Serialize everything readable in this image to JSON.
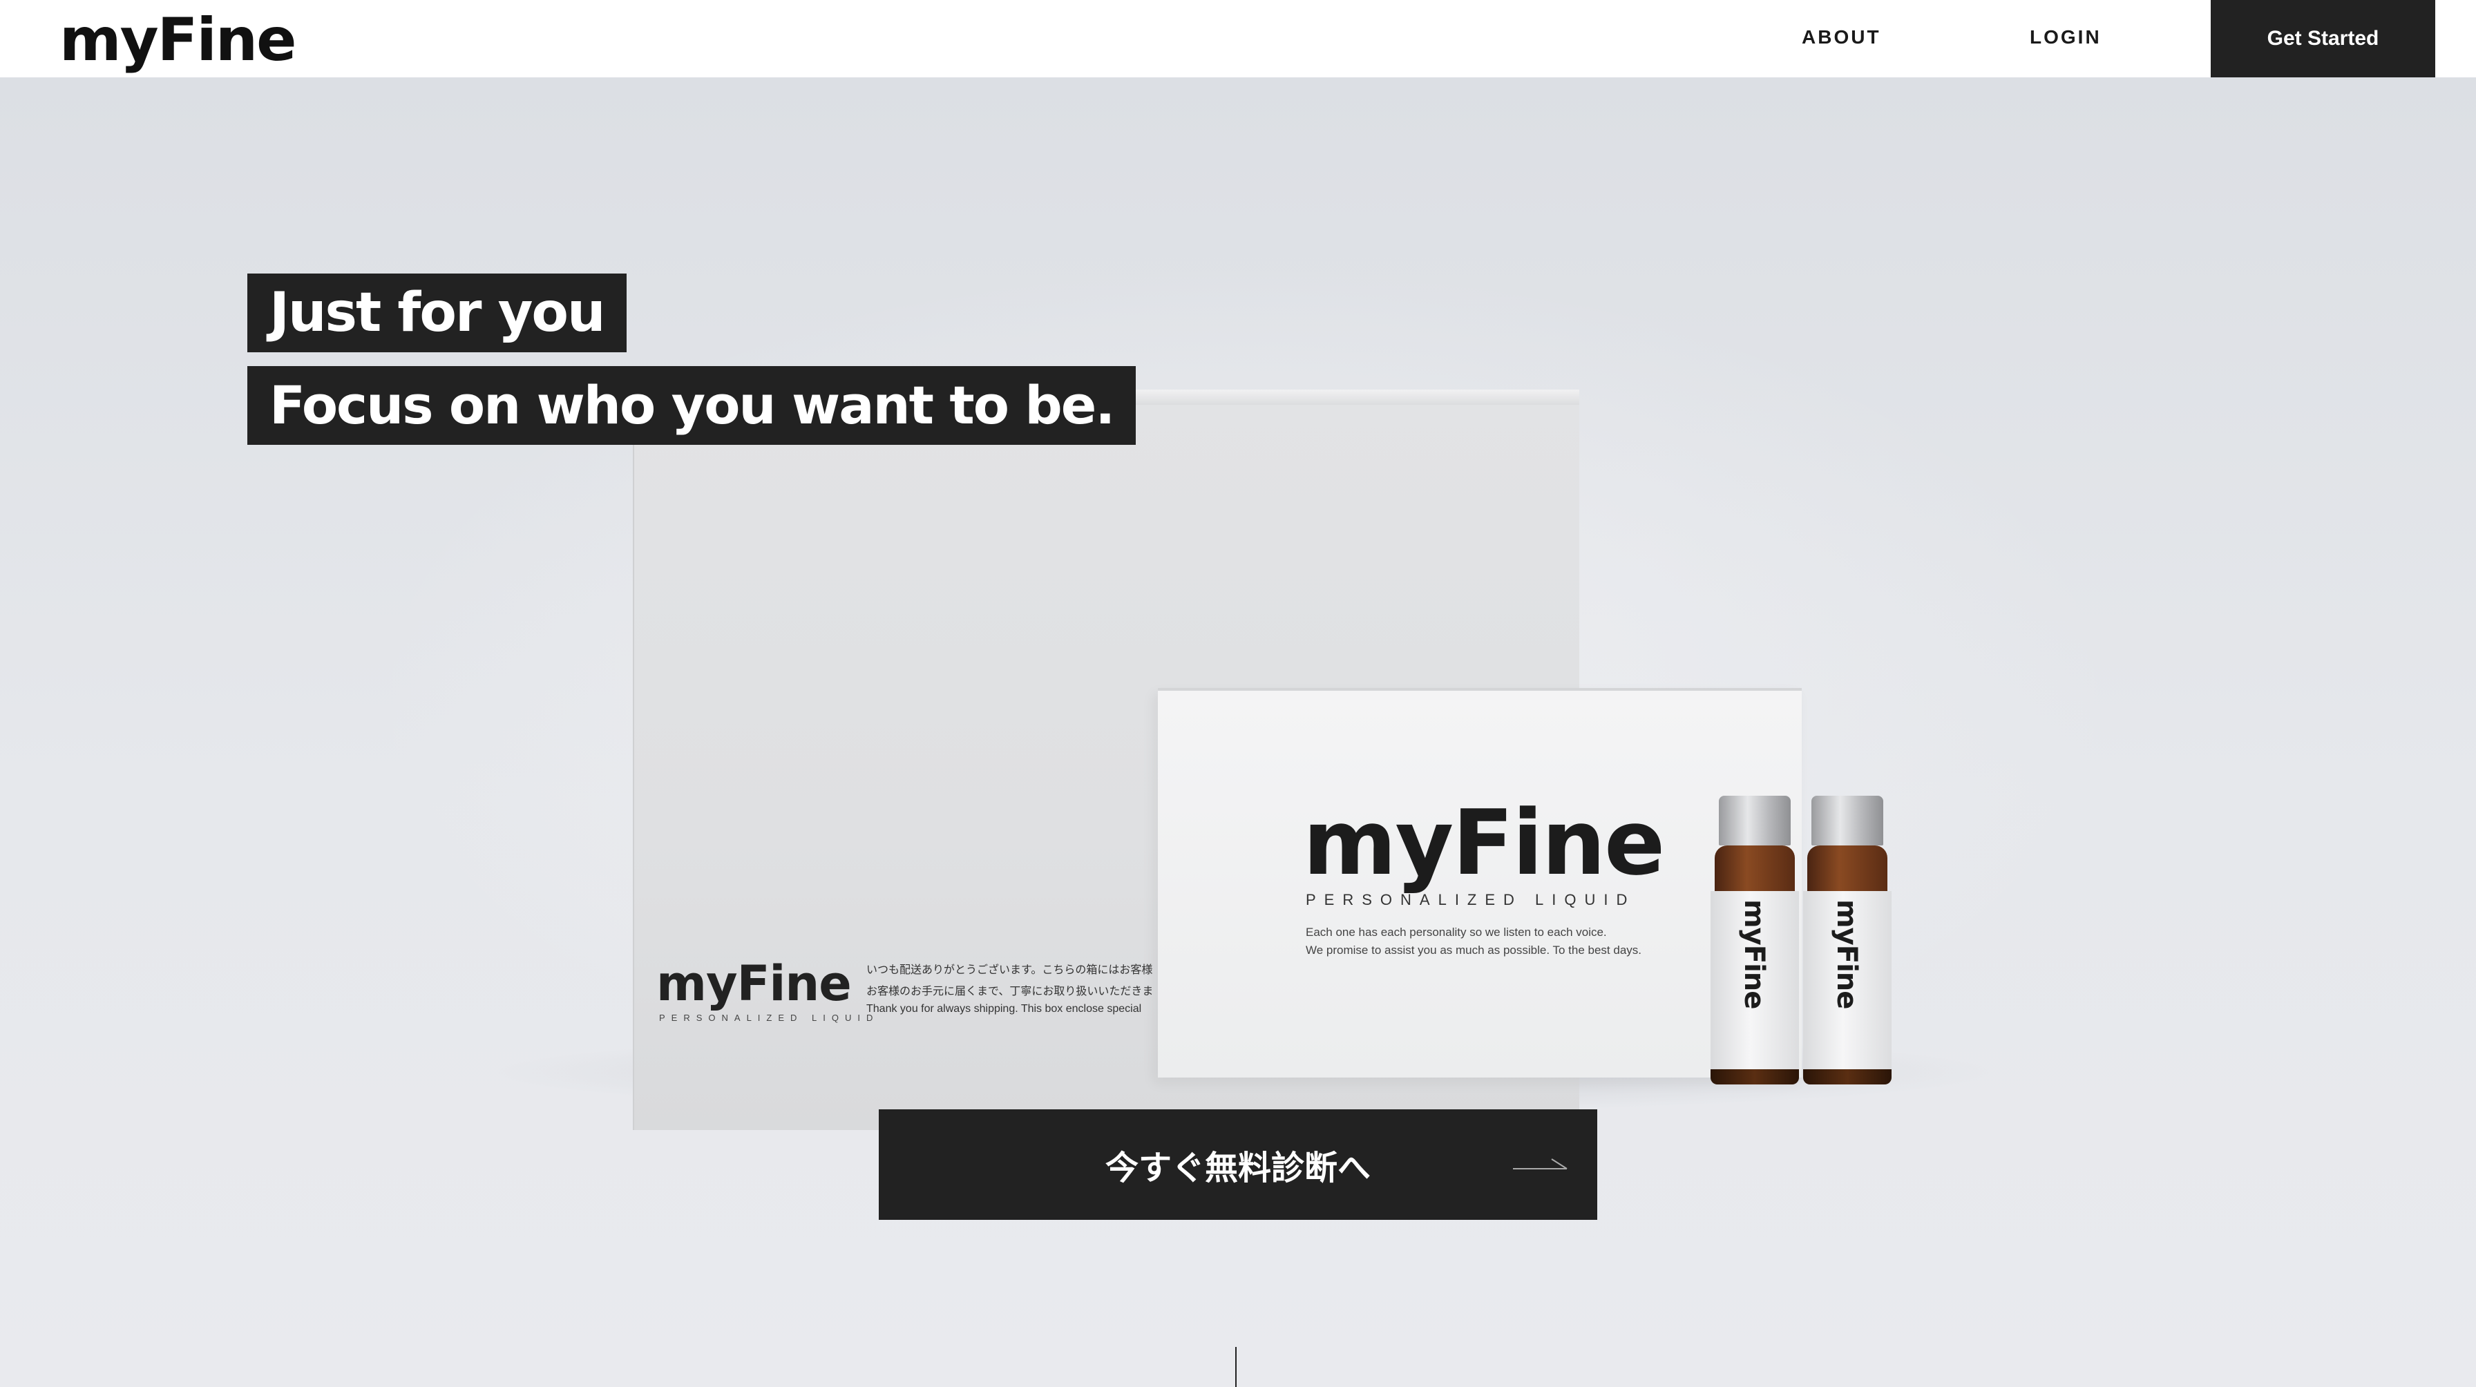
{
  "header": {
    "logo": "myFine",
    "nav": {
      "about": "ABOUT",
      "login": "LOGIN"
    },
    "cta_label": "Get Started"
  },
  "hero": {
    "headline_1": "Just for you",
    "headline_2": "Focus on who you want to be.",
    "cta_label": "今すぐ無料診断へ"
  },
  "product": {
    "big_box": {
      "logo": "myFine",
      "tagline": "PERSONALIZED LIQUID",
      "line_1": "いつも配送ありがとうございます。こちらの箱にはお客様",
      "line_2": "お客様のお手元に届くまで、丁寧にお取り扱いいただきま",
      "line_3": "Thank you for always shipping. This box enclose special"
    },
    "small_box": {
      "logo": "myFine",
      "tagline": "PERSONALIZED LIQUID",
      "line_1": "Each one has each personality so we listen to each voice.",
      "line_2": "We promise to assist you as much as possible. To the best days."
    },
    "bottle_label": "myFine"
  },
  "colors": {
    "dark": "#222222",
    "header_bg": "#ffffff",
    "hero_bg": "#e4e6ea"
  }
}
